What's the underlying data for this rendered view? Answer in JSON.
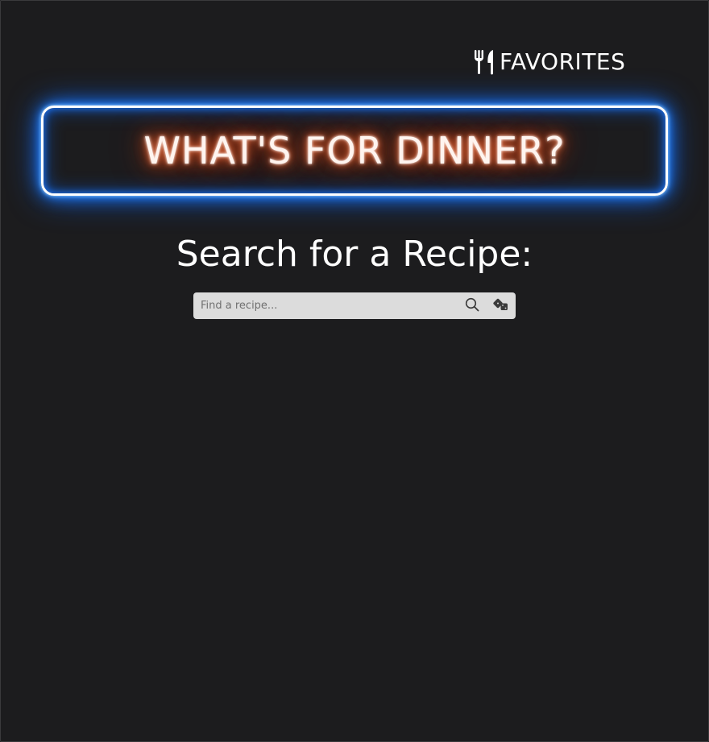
{
  "header": {
    "favorites_label": "FAVORITES",
    "favorites_icon": "utensils-icon"
  },
  "hero": {
    "title": "WHAT'S FOR DINNER?"
  },
  "search": {
    "heading": "Search for a Recipe:",
    "placeholder": "Find a recipe...",
    "value": "",
    "search_icon": "search-icon",
    "random_icon": "dice-icon"
  },
  "colors": {
    "background": "#1c1c1e",
    "neon_frame": "#1f78ff",
    "neon_title_glow": "#e0501e",
    "search_bar": "#dcdcdc",
    "text": "#ffffff"
  }
}
